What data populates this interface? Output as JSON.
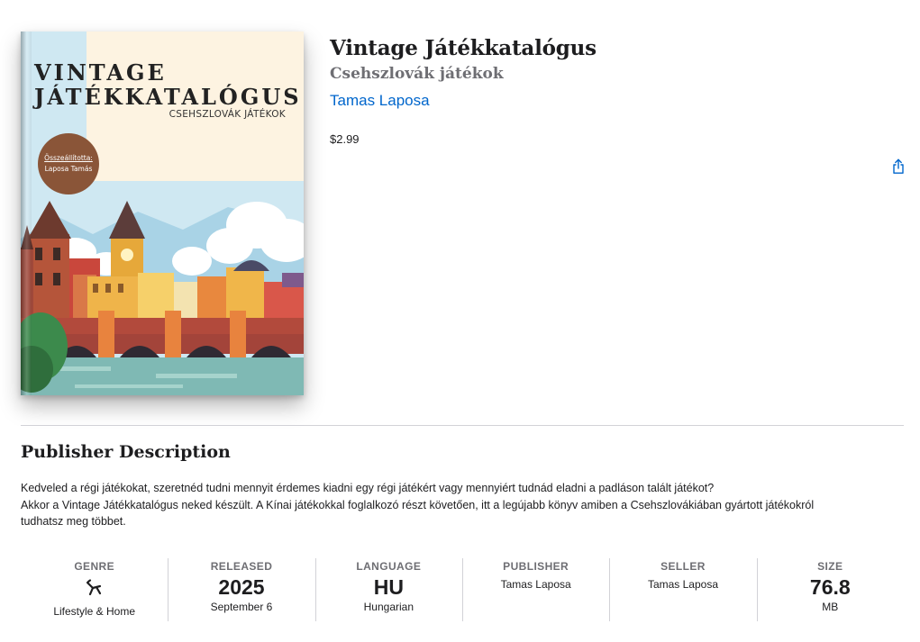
{
  "book": {
    "title": "Vintage Játékkatalógus",
    "subtitle": "Csehszlovák játékok",
    "author": "Tamas Laposa",
    "price": "$2.99"
  },
  "cover": {
    "title_line1": "VINTAGE",
    "title_line2": "JÁTÉKKATALÓGUS",
    "subtitle": "CSEHSZLOVÁK JÁTÉKOK",
    "badge_label": "Összeállította:",
    "badge_name": "Laposa Tamás"
  },
  "actions": {
    "share_icon": "share-icon"
  },
  "description": {
    "heading": "Publisher Description",
    "lines": [
      "Kedveled a régi játékokat, szeretnéd tudni mennyit érdemes kiadni egy régi játékért vagy mennyiért tudnád eladni a padláson talált játékot?",
      "Akkor a Vintage Játékkatalógus neked készült. A Kínai játékokkal foglalkozó részt követően, itt a legújabb könyv amiben a Csehszlovákiában gyártott játékokról",
      "tudhatsz meg többet."
    ]
  },
  "info": {
    "genre": {
      "label": "GENRE",
      "icon": "lifestyle-icon",
      "sub": "Lifestyle & Home"
    },
    "released": {
      "label": "RELEASED",
      "value": "2025",
      "sub": "September 6"
    },
    "language": {
      "label": "LANGUAGE",
      "value": "HU",
      "sub": "Hungarian"
    },
    "publisher": {
      "label": "PUBLISHER",
      "value": "Tamas Laposa"
    },
    "seller": {
      "label": "SELLER",
      "value": "Tamas Laposa"
    },
    "size": {
      "label": "SIZE",
      "value": "76.8",
      "sub": "MB"
    }
  },
  "colors": {
    "link": "#0066cc",
    "secondary_text": "#6e6e73",
    "divider": "#d2d2d7"
  }
}
